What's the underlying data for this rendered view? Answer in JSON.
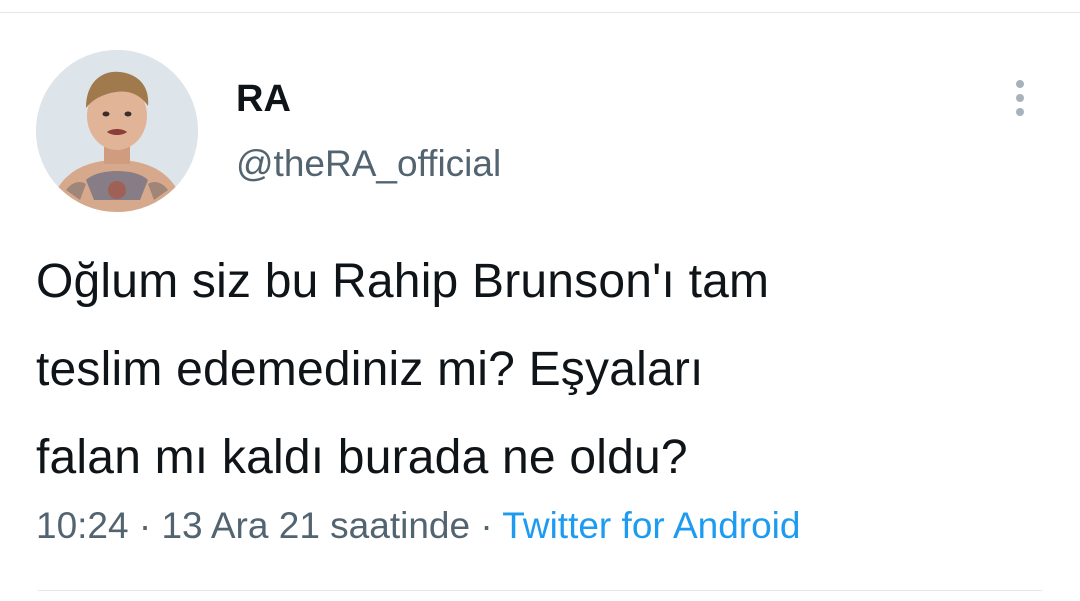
{
  "author": {
    "display_name": "RA",
    "handle": "@theRA_official"
  },
  "tweet": {
    "lines": [
      "Oğlum siz bu Rahip Brunson'ı tam",
      "teslim edemediniz mi? Eşyaları",
      "falan mı kaldı burada ne oldu?"
    ]
  },
  "meta": {
    "time": "10:24",
    "separator": "·",
    "date": "13 Ara 21 saatinde",
    "source": "Twitter for Android"
  },
  "icons": {
    "menu": "more-vertical-icon"
  },
  "colors": {
    "text": "#0f1419",
    "secondary": "#536471",
    "link": "#1d9bf0",
    "divider": "#e3e7ea"
  }
}
